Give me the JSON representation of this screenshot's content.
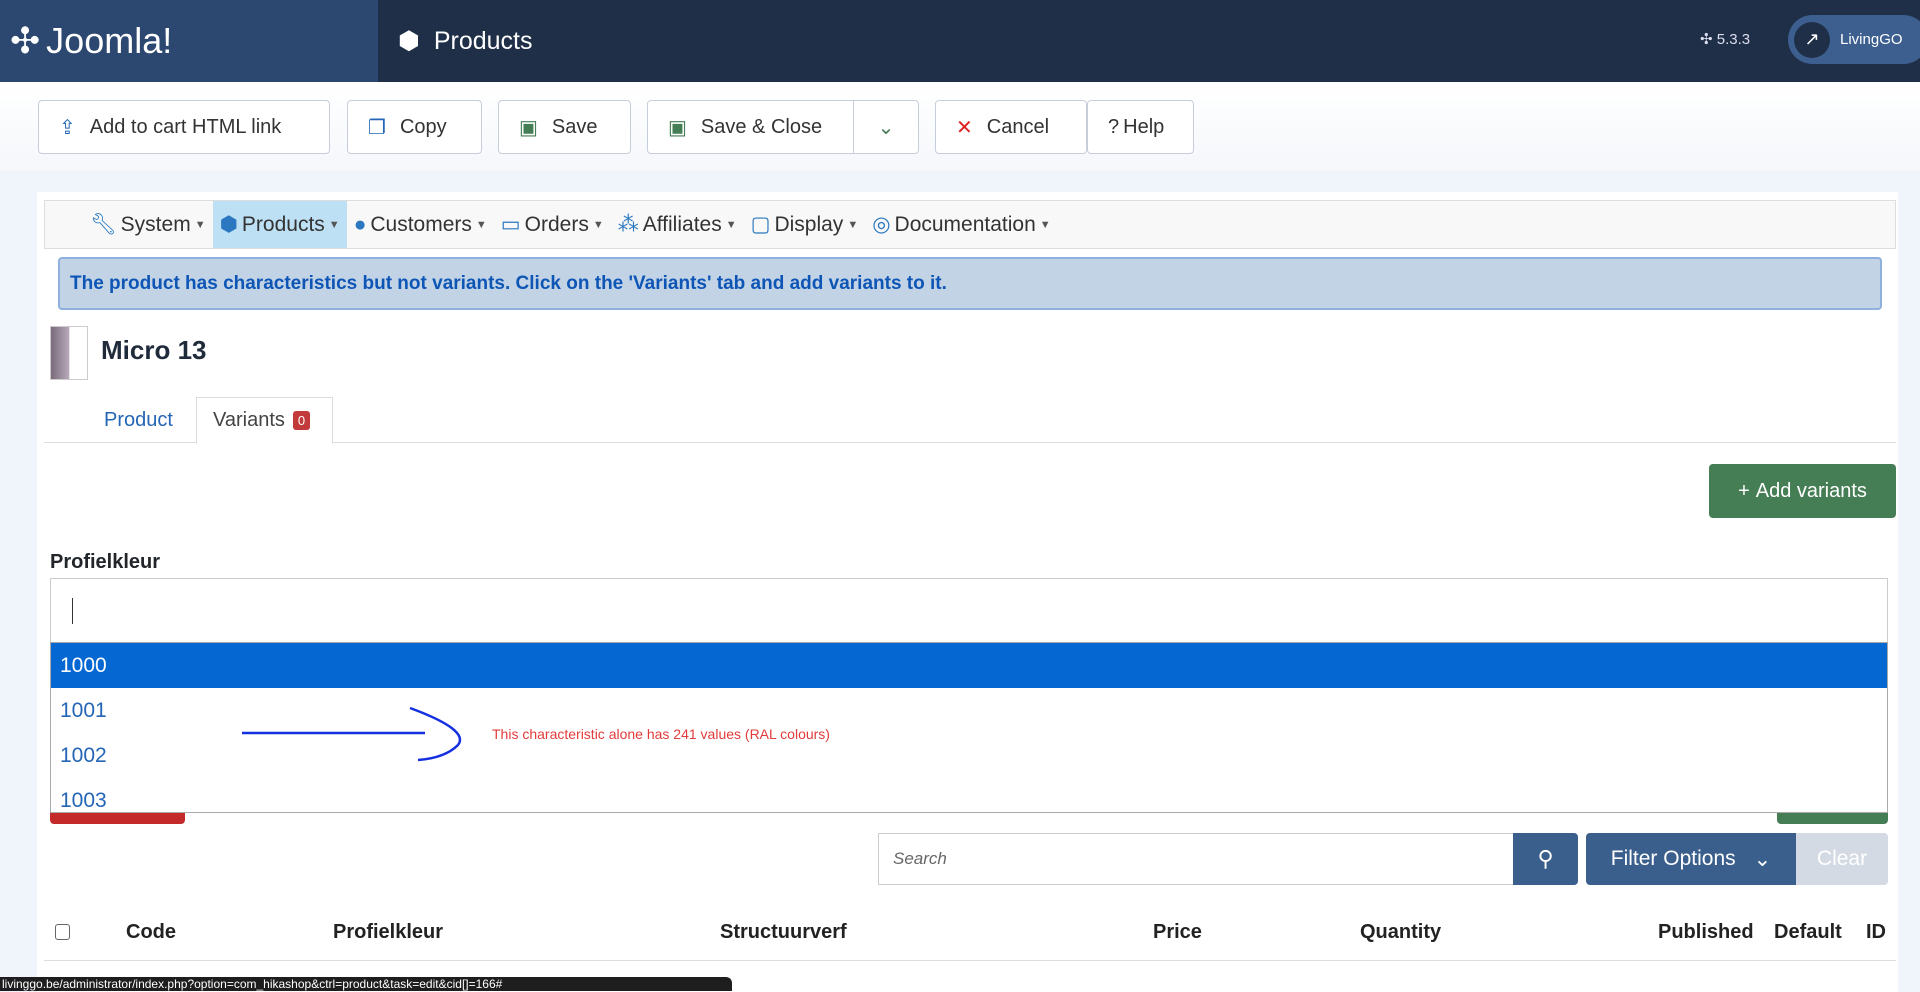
{
  "header": {
    "brand": "Joomla!",
    "title": "Products",
    "version": "5.3.3",
    "user": "LivingGO"
  },
  "toolbar": {
    "add_cart": "Add to cart HTML link",
    "copy": "Copy",
    "save": "Save",
    "save_close": "Save & Close",
    "cancel": "Cancel",
    "help": "Help"
  },
  "menu": [
    {
      "label": "System"
    },
    {
      "label": "Products"
    },
    {
      "label": "Customers"
    },
    {
      "label": "Orders"
    },
    {
      "label": "Affiliates"
    },
    {
      "label": "Display"
    },
    {
      "label": "Documentation"
    }
  ],
  "alert": "The product has characteristics but not variants. Click on the 'Variants' tab and add variants to it.",
  "product": {
    "name": "Micro 13"
  },
  "tabs": {
    "product": "Product",
    "variants": "Variants",
    "variants_count": "0"
  },
  "add_variants": "Add variants",
  "characteristic": {
    "label": "Profielkleur",
    "value": "",
    "options": [
      "1000",
      "1001",
      "1002",
      "1003"
    ],
    "selected": "1000"
  },
  "annotation": "This characteristic alone has 241 values (RAL colours)",
  "filters": {
    "search_placeholder": "Search",
    "filter_options": "Filter Options",
    "clear": "Clear"
  },
  "table": {
    "columns": [
      "Code",
      "Profielkleur",
      "Structuurverf",
      "Price",
      "Quantity",
      "Published",
      "Default",
      "ID"
    ]
  },
  "status_url": "livinggo.be/administrator/index.php?option=com_hikashop&ctrl=product&task=edit&cid[]=166#",
  "colors": {
    "header": "#1f2f48",
    "accent": "#3b5f8d",
    "success": "#457d54",
    "danger": "#c52a2a",
    "selected": "#0467d2"
  }
}
